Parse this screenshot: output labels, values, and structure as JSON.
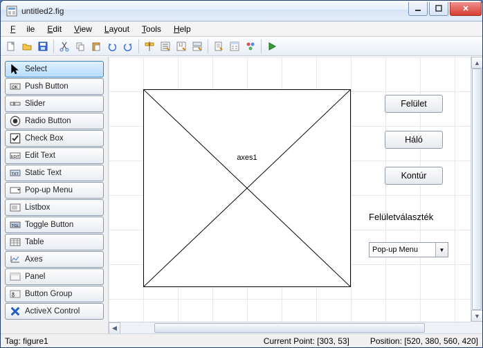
{
  "window": {
    "title": "untitled2.fig"
  },
  "menu": {
    "file": "File",
    "edit": "Edit",
    "view": "View",
    "layout": "Layout",
    "tools": "Tools",
    "help": "Help"
  },
  "palette": {
    "items": [
      {
        "label": "Select",
        "selected": true
      },
      {
        "label": "Push Button"
      },
      {
        "label": "Slider"
      },
      {
        "label": "Radio Button"
      },
      {
        "label": "Check Box"
      },
      {
        "label": "Edit Text"
      },
      {
        "label": "Static Text"
      },
      {
        "label": "Pop-up Menu"
      },
      {
        "label": "Listbox"
      },
      {
        "label": "Toggle Button"
      },
      {
        "label": "Table"
      },
      {
        "label": "Axes"
      },
      {
        "label": "Panel"
      },
      {
        "label": "Button Group"
      },
      {
        "label": "ActiveX Control"
      }
    ]
  },
  "canvas": {
    "axes_label": "axes1",
    "buttons": [
      {
        "label": "Felület"
      },
      {
        "label": "Háló"
      },
      {
        "label": "Kontúr"
      }
    ],
    "label": "Felületválaszték",
    "popup_value": "Pop-up Menu"
  },
  "status": {
    "tag": "Tag: figure1",
    "current_point": "Current Point: [303, 53]",
    "position": "Position: [520, 380, 560, 420]"
  }
}
